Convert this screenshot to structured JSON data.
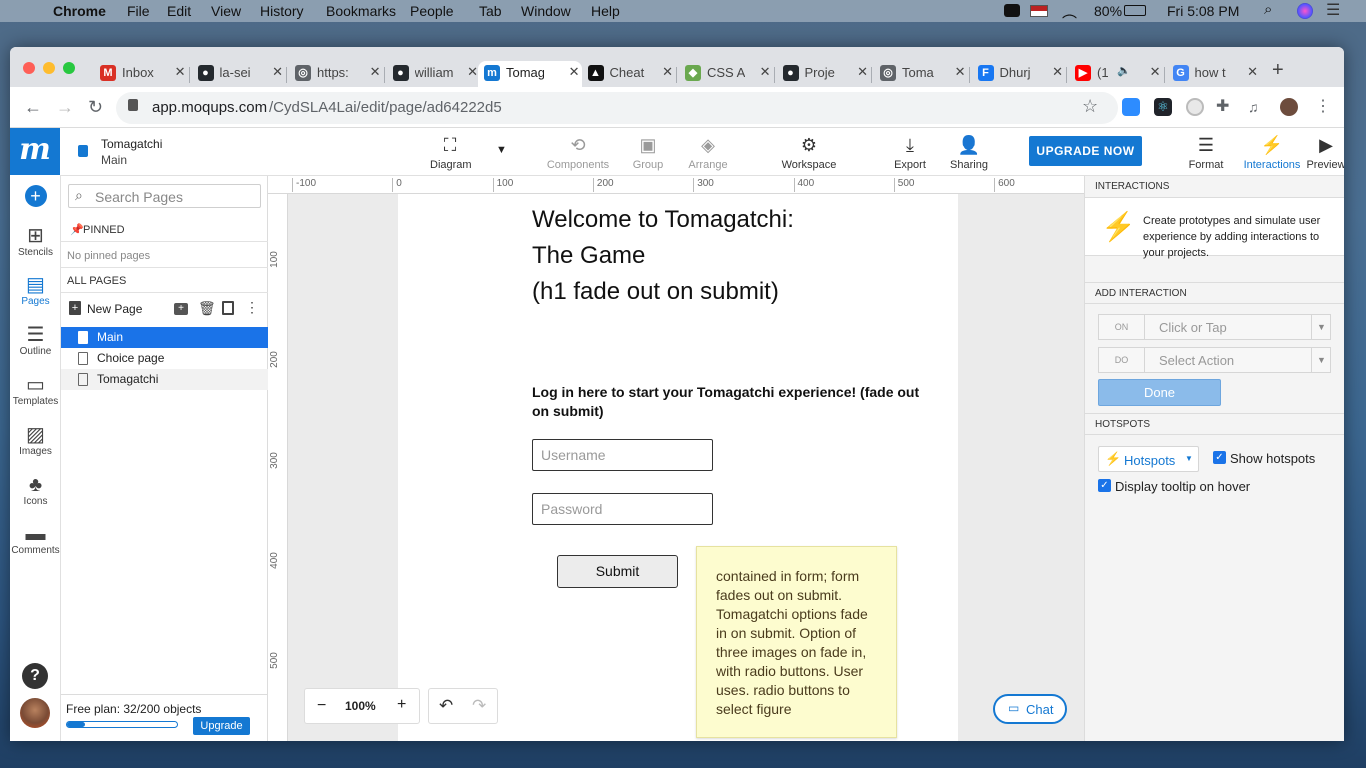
{
  "menubar": {
    "app": "Chrome",
    "items": [
      "File",
      "Edit",
      "View",
      "History",
      "Bookmarks",
      "People",
      "Tab",
      "Window",
      "Help"
    ],
    "battery": "80%",
    "clock": "Fri 5:08 PM"
  },
  "tabs": [
    {
      "title": "Inbox",
      "icon": "gmail-icon",
      "color": "#d93025",
      "glyph": "M"
    },
    {
      "title": "la-sei",
      "icon": "github-icon",
      "color": "#24292e",
      "glyph": "●"
    },
    {
      "title": "https:",
      "icon": "globe-icon",
      "color": "#5f6368",
      "glyph": "◎"
    },
    {
      "title": "william",
      "icon": "github-icon",
      "color": "#24292e",
      "glyph": "●"
    },
    {
      "title": "Tomag",
      "icon": "moqups-icon",
      "color": "#1478d2",
      "glyph": "m",
      "active": true
    },
    {
      "title": "Cheat",
      "icon": "cheatsheet-icon",
      "color": "#111",
      "glyph": "▲"
    },
    {
      "title": "CSS A",
      "icon": "css-icon",
      "color": "#6aa84f",
      "glyph": "◆"
    },
    {
      "title": "Proje",
      "icon": "github-icon",
      "color": "#24292e",
      "glyph": "●"
    },
    {
      "title": "Toma",
      "icon": "globe-icon",
      "color": "#5f6368",
      "glyph": "◎"
    },
    {
      "title": "Dhurj",
      "icon": "facebook-icon",
      "color": "#1877f2",
      "glyph": "F"
    },
    {
      "title": "(1",
      "icon": "youtube-icon",
      "color": "#ff0000",
      "glyph": "▶",
      "audio": "🔈"
    },
    {
      "title": "how t",
      "icon": "google-icon",
      "color": "#4285f4",
      "glyph": "G"
    }
  ],
  "address": {
    "host": "app.moqups.com",
    "path": "/CydSLA4Lai/edit/page/ad64222d5"
  },
  "project": {
    "name": "Tomagatchi",
    "page": "Main"
  },
  "toolbar": {
    "diagram": "Diagram",
    "components": "Components",
    "group": "Group",
    "arrange": "Arrange",
    "workspace": "Workspace",
    "export": "Export",
    "sharing": "Sharing",
    "upgrade": "UPGRADE NOW",
    "format": "Format",
    "interactions": "Interactions",
    "preview": "Preview"
  },
  "rail": [
    {
      "label": "",
      "icon": "add-icon"
    },
    {
      "label": "Stencils",
      "icon": "stencils-icon"
    },
    {
      "label": "Pages",
      "icon": "pages-icon",
      "active": true
    },
    {
      "label": "Outline",
      "icon": "outline-icon"
    },
    {
      "label": "Templates",
      "icon": "templates-icon"
    },
    {
      "label": "Images",
      "icon": "images-icon"
    },
    {
      "label": "Icons",
      "icon": "club-icon"
    },
    {
      "label": "Comments",
      "icon": "comments-icon"
    }
  ],
  "pages_panel": {
    "search_placeholder": "Search Pages",
    "pinned_header": "PINNED",
    "no_pinned": "No pinned pages",
    "all_pages_header": "ALL PAGES",
    "new_page": "New Page",
    "pages": [
      "Main",
      "Choice page",
      "Tomagatchi"
    ],
    "plan": "Free plan: 32/200 objects",
    "plan_progress": 0.16,
    "upgrade": "Upgrade"
  },
  "ruler": {
    "top": [
      "-100",
      "0",
      "100",
      "200",
      "300",
      "400",
      "500",
      "600"
    ],
    "left": [
      "100",
      "200",
      "300",
      "400",
      "500"
    ]
  },
  "canvas": {
    "heading_lines": [
      "Welcome to Tomagatchi:",
      "The Game",
      "(h1 fade out on submit)"
    ],
    "subheading": "Log in here to start your Tomagatchi experience! (fade out on submit)",
    "username_placeholder": "Username",
    "password_placeholder": "Password",
    "submit": "Submit",
    "sticky_note": "contained in form; form fades out on submit. Tomagatchi options fade in on submit. Option of three images on fade in, with radio buttons. User uses. radio buttons to select figure",
    "zoom": "100%",
    "chat": "Chat"
  },
  "interactions": {
    "header": "INTERACTIONS",
    "description": "Create prototypes and simulate user experience by adding interactions to your projects.",
    "add_header": "ADD INTERACTION",
    "on_tag": "ON",
    "on_value": "Click or Tap",
    "do_tag": "DO",
    "do_value": "Select Action",
    "done": "Done",
    "hotspots_header": "HOTSPOTS",
    "hotspots_btn": "Hotspots",
    "show_hotspots": "Show hotspots",
    "display_tooltip": "Display tooltip on hover"
  },
  "colors": {
    "brand": "#1478d2",
    "sticky": "#fdfccf",
    "selected": "#1a73e8"
  }
}
